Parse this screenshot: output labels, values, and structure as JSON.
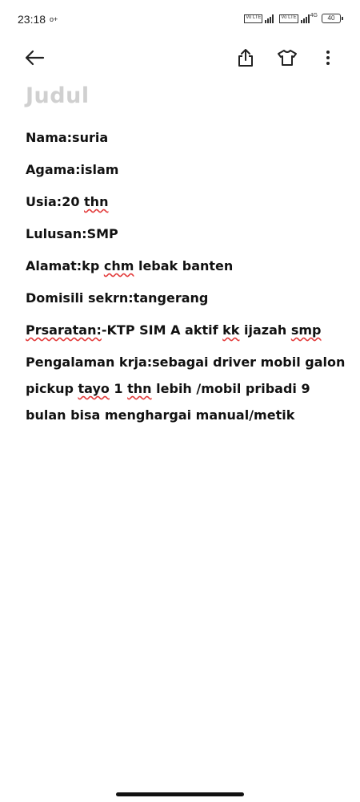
{
  "status": {
    "time": "23:18",
    "notification_icon": "o+",
    "sim1": "Vo LTE",
    "sim2": "Vo LTE",
    "network": "4G",
    "battery": "40"
  },
  "toolbar": {
    "back_icon": "arrow-left-icon",
    "share_icon": "share-icon",
    "theme_icon": "shirt-icon",
    "more_icon": "more-vert-icon"
  },
  "note": {
    "title_placeholder": "Judul",
    "lines": {
      "nama": "Nama:suria",
      "agama": "Agama:islam",
      "usia_a": "Usia:20 ",
      "usia_b": "thn",
      "lulusan": "Lulusan:SMP",
      "alamat_a": "Alamat:kp ",
      "alamat_b": "chm",
      "alamat_c": " lebak banten",
      "domisili": "Domisili sekrn:tangerang",
      "syarat_a": "Prsaratan:",
      "syarat_b": "-KTP SIM A aktif ",
      "syarat_c": "kk",
      "syarat_d": " ijazah ",
      "syarat_e": "smp",
      "pengalaman_a": "Pengalaman krja:sebagai driver mobil galon pickup ",
      "pengalaman_b": "tayo",
      "pengalaman_c": " 1 ",
      "pengalaman_d": "thn",
      "pengalaman_e": " lebih /mobil pribadi 9 bulan bisa menghargai manual/metik"
    }
  }
}
